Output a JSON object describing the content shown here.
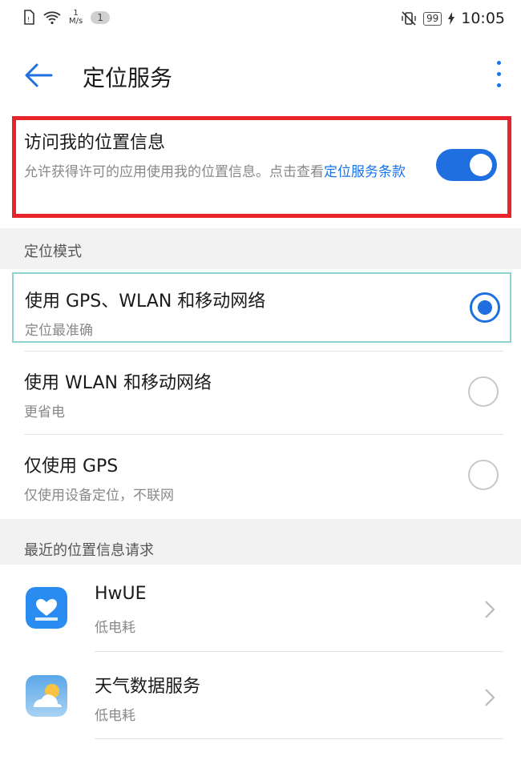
{
  "status_bar": {
    "speed_value": "1",
    "speed_unit": "M/s",
    "notification_count": "1",
    "battery": "99",
    "time": "10:05"
  },
  "app_bar": {
    "title": "定位服务"
  },
  "access": {
    "title": "访问我的位置信息",
    "description": "允许获得许可的应用使用我的位置信息。点击查看",
    "link": "定位服务条款",
    "enabled": true
  },
  "mode_section": {
    "header": "定位模式",
    "items": [
      {
        "label": "使用 GPS、WLAN 和移动网络",
        "sub": "定位最准确",
        "selected": true
      },
      {
        "label": "使用 WLAN 和移动网络",
        "sub": "更省电",
        "selected": false
      },
      {
        "label": "仅使用 GPS",
        "sub": "仅使用设备定位，不联网",
        "selected": false
      }
    ]
  },
  "recent_section": {
    "header": "最近的位置信息请求",
    "apps": [
      {
        "name": "HwUE",
        "sub": "低电耗",
        "icon": "hwue-app-icon"
      },
      {
        "name": "天气数据服务",
        "sub": "低电耗",
        "icon": "weather-app-icon"
      }
    ]
  },
  "colors": {
    "accent": "#1f6fe0",
    "highlight": "#e8242b",
    "selected_border": "#8fd3cf"
  }
}
